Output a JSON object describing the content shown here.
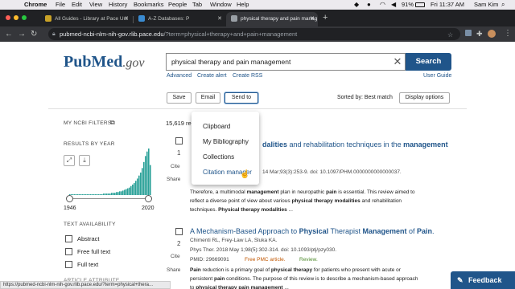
{
  "menubar": {
    "app": "Chrome",
    "items": [
      "File",
      "Edit",
      "View",
      "History",
      "Bookmarks",
      "People",
      "Tab",
      "Window",
      "Help"
    ],
    "battery": "91%",
    "clock": "Fri 11:37 AM",
    "user": "Sam Kim"
  },
  "tabs": [
    {
      "label": "All Guides - Library at Pace Uni"
    },
    {
      "label": "A-Z Databases: P"
    },
    {
      "label": "physical therapy and pain manag"
    }
  ],
  "address": {
    "host": "pubmed-ncbi-nlm-nih-gov.rlib.pace.edu",
    "path": "/?term=physical+therapy+and+pain+management"
  },
  "header": {
    "logo_main": "PubMed",
    "logo_suffix": ".gov",
    "search_value": "physical therapy and pain management",
    "search_button": "Search",
    "links": [
      "Advanced",
      "Create alert",
      "Create RSS"
    ],
    "user_guide": "User Guide"
  },
  "actions": {
    "save": "Save",
    "email": "Email",
    "send_to": "Send to",
    "sorted_by": "Sorted by: Best match",
    "display_options": "Display options"
  },
  "dropdown": {
    "items": [
      "Clipboard",
      "My Bibliography",
      "Collections",
      "Citation manager"
    ]
  },
  "sidebar": {
    "my_filters": "MY NCBI FILTERS",
    "results_by_year": "RESULTS BY YEAR",
    "year_start": "1946",
    "year_end": "2020",
    "text_availability": "TEXT AVAILABILITY",
    "checkboxes": [
      "Abstract",
      "Free full text",
      "Full text"
    ],
    "article_attribute": "ARTICLE ATTRIBUTE"
  },
  "results": {
    "count": "15,619 re",
    "items": [
      {
        "number": "1",
        "title_pre": "",
        "title_bold_1": "dalities",
        "title_mid": " and rehabilitation techniques in the ",
        "title_bold_2": "management",
        "meta": "14 Mar;93(3):253-9. doi: 10.1097/PHM.0000000000000037.",
        "snippet_1": "Therefore, a multimodal management plan in neuropathic pain is essential. This review aimed to",
        "snippet_2": "reflect a diverse point of view about various physical therapy modalities and rehabilitation",
        "snippet_3": "techniques. Physical therapy modalities ...",
        "cite": "Cite",
        "share": "Share"
      },
      {
        "number": "2",
        "title": "A Mechanism-Based Approach to Physical Therapist Management of Pain.",
        "authors": "Chimenti RL, Frey-Law LA, Sluka KA.",
        "journal": "Phys Ther. 2018 May 1;98(5):302-314. doi: 10.1093/ptj/pzy030.",
        "pmid": "PMID: 29669091",
        "free": "Free PMC article.",
        "review": "Review.",
        "snippet_1": "Pain reduction is a primary goal of physical therapy for patients who present with acute or",
        "snippet_2": "persistent pain conditions. The purpose of this review is to describe a mechanism-based approach",
        "snippet_3": "to physical therapy pain management ...",
        "cite": "Cite",
        "share": "Share"
      }
    ]
  },
  "histogram": {
    "values": [
      1,
      1,
      1,
      1,
      1,
      1,
      1,
      1,
      1,
      1,
      1,
      1,
      1,
      1,
      1,
      1,
      1,
      1,
      1,
      1,
      1,
      2,
      2,
      2,
      2,
      2,
      3,
      3,
      3,
      4,
      4,
      5,
      5,
      6,
      7,
      8,
      9,
      10,
      12,
      14,
      16,
      19,
      22,
      26,
      30,
      36,
      44,
      52,
      58,
      62,
      40
    ]
  },
  "status_url": "https://pubmed-ncbi-nlm-nih-gov.rlib.pace.edu/?term=physical+thera...",
  "feedback": "Feedback",
  "colors": {
    "brand": "#20558a",
    "pmc_free": "#c05600",
    "hist_bar": "#2aa198"
  }
}
